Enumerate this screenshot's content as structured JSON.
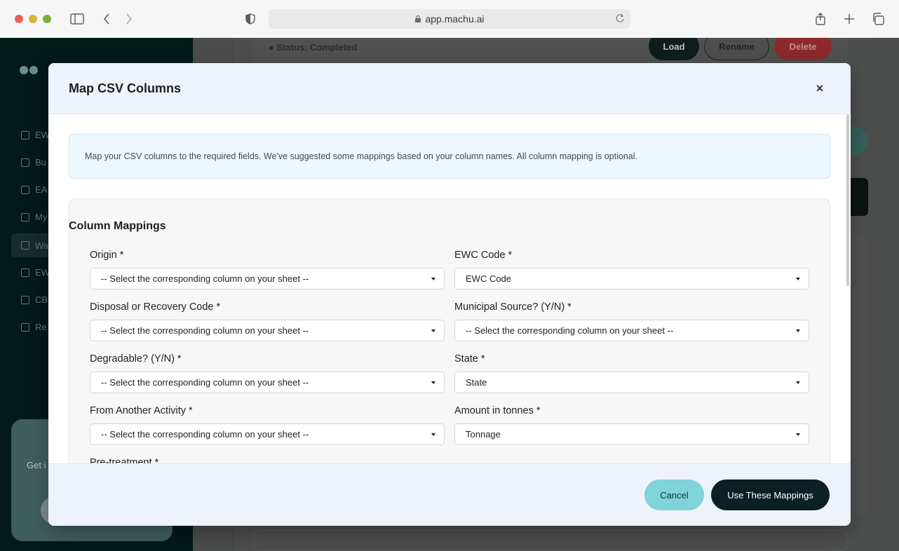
{
  "browser": {
    "url": "app.machu.ai"
  },
  "background": {
    "status": "● Status: Completed",
    "buttons": {
      "load": "Load",
      "rename": "Rename",
      "delete": "Delete"
    },
    "sidebar_items": [
      "EW",
      "Bu",
      "EA",
      "My",
      "Wa",
      "EW",
      "CB",
      "Re"
    ],
    "promo_text": "Get i"
  },
  "modal": {
    "title": "Map CSV Columns",
    "close_label": "×",
    "info_text": "Map your CSV columns to the required fields. We've suggested some mappings based on your column names. All column mapping is optional.",
    "section_title": "Column Mappings",
    "fields": [
      {
        "label": "Origin *",
        "value": "-- Select the corresponding column on your sheet --"
      },
      {
        "label": "EWC Code *",
        "value": "EWC Code"
      },
      {
        "label": "Disposal or Recovery Code *",
        "value": "-- Select the corresponding column on your sheet --"
      },
      {
        "label": "Municipal Source? (Y/N) *",
        "value": "-- Select the corresponding column on your sheet --"
      },
      {
        "label": "Degradable? (Y/N) *",
        "value": "-- Select the corresponding column on your sheet --"
      },
      {
        "label": "State *",
        "value": "State"
      },
      {
        "label": "From Another Activity *",
        "value": "-- Select the corresponding column on your sheet --"
      },
      {
        "label": "Amount in tonnes *",
        "value": "Tonnage"
      },
      {
        "label": "Pre-treatment *",
        "value": ""
      }
    ],
    "footer": {
      "cancel": "Cancel",
      "confirm": "Use These Mappings"
    }
  }
}
